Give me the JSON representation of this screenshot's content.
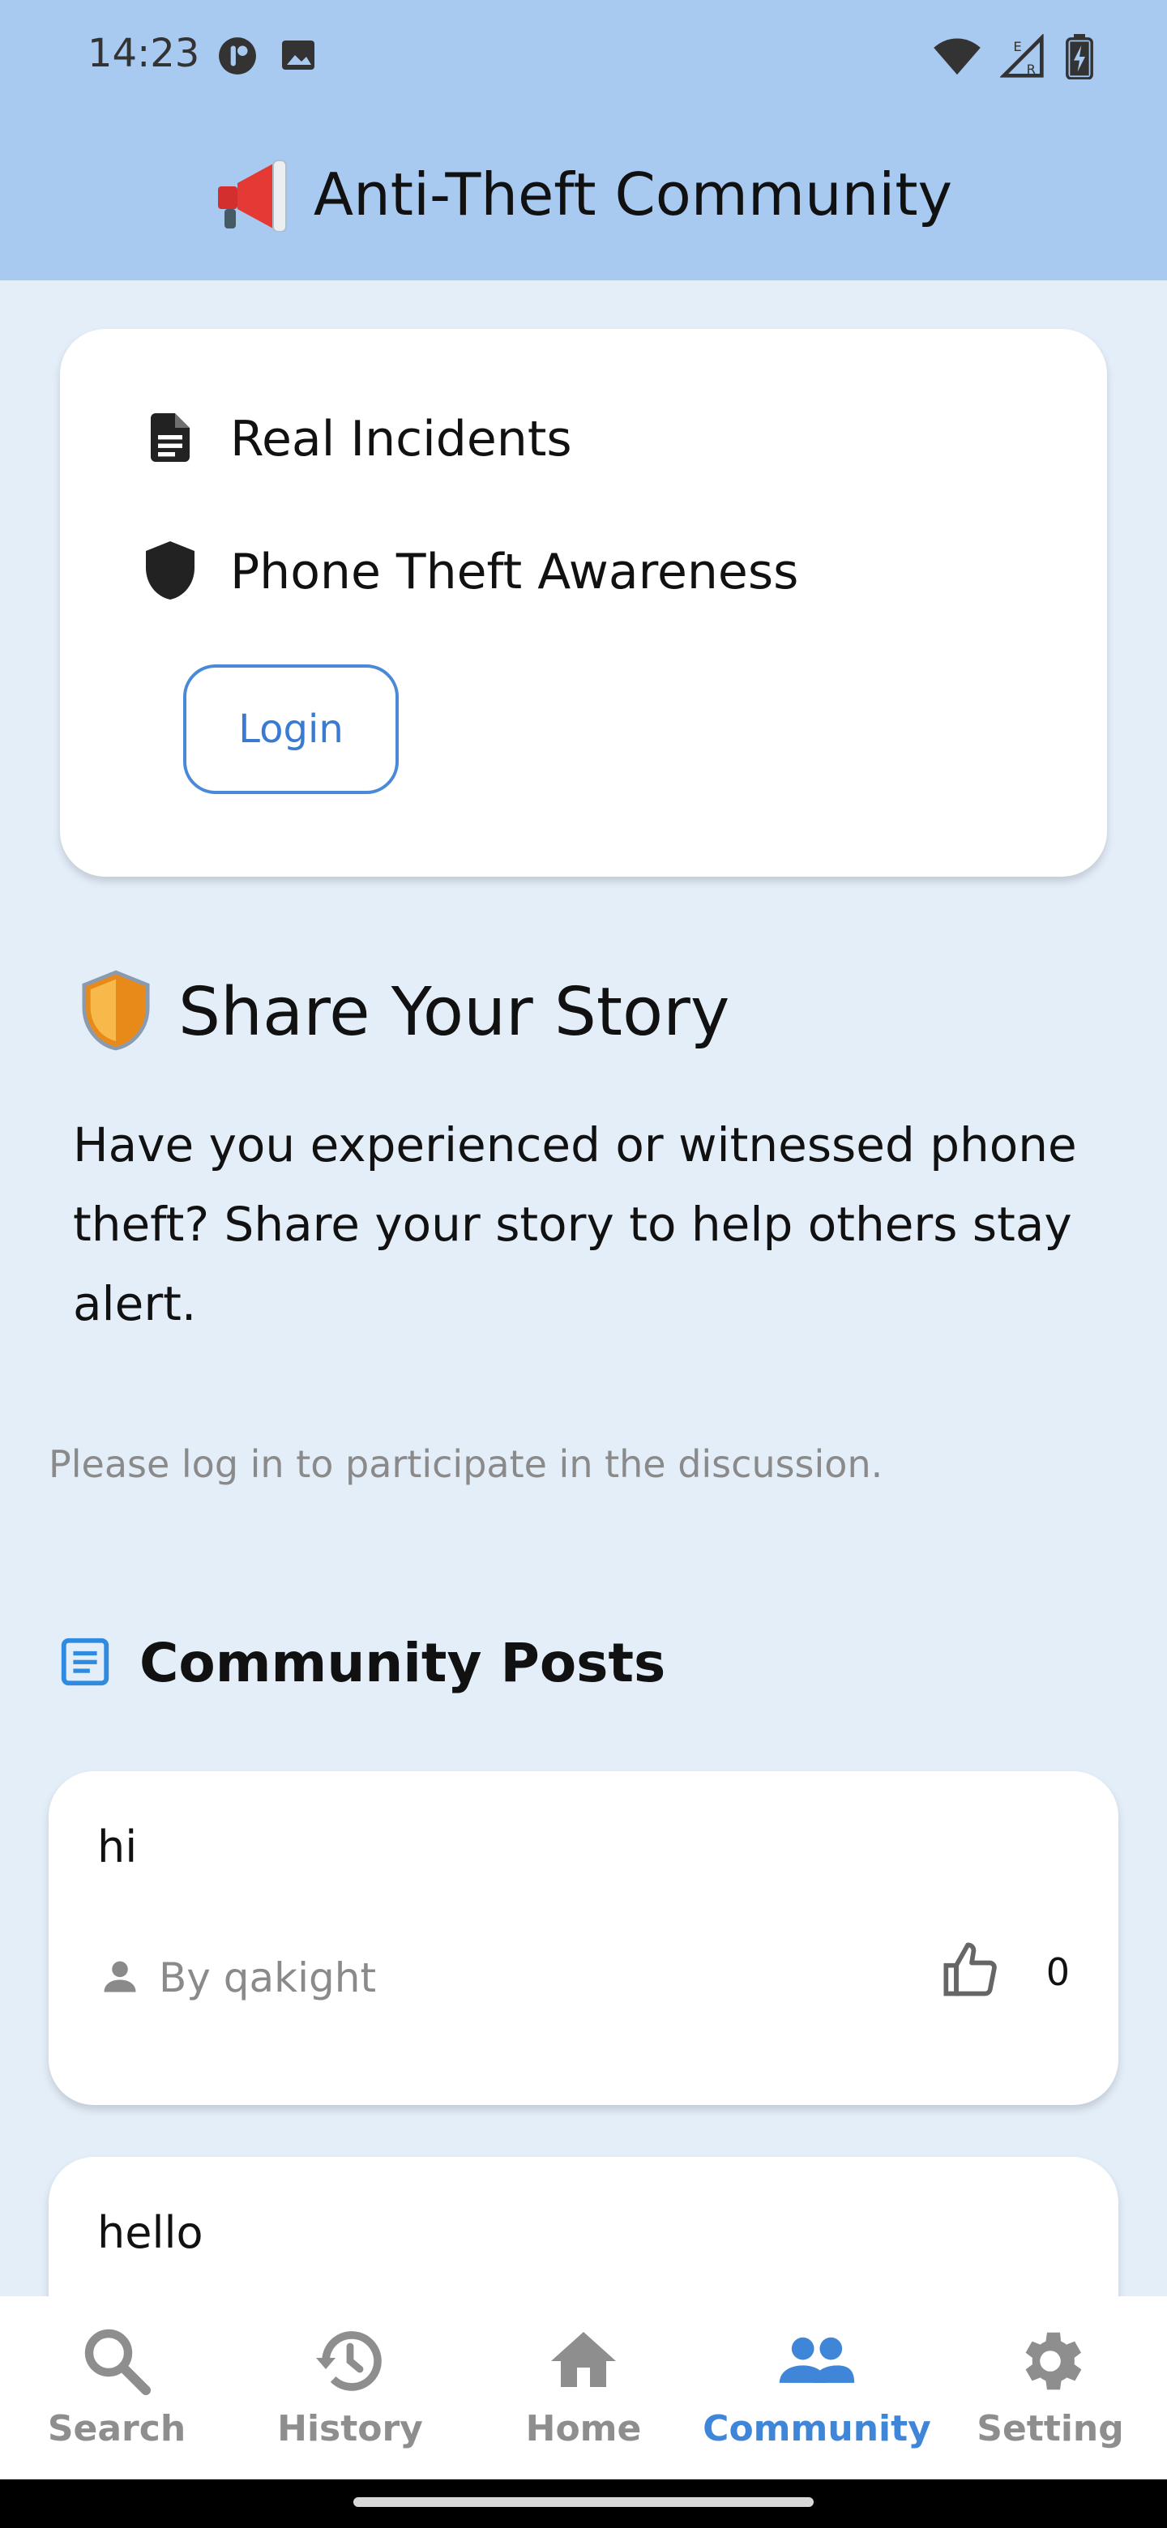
{
  "status_bar": {
    "time": "14:23",
    "left_icons": [
      "app-notification-icon",
      "image-icon"
    ],
    "right_icons": [
      "wifi-icon",
      "signal-icon",
      "battery-charging-icon"
    ]
  },
  "header": {
    "icon": "megaphone-icon",
    "title": "Anti-Theft Community"
  },
  "info_card": {
    "items": [
      {
        "icon": "document-icon",
        "label": "Real Incidents"
      },
      {
        "icon": "shield-icon",
        "label": "Phone Theft Awareness"
      }
    ],
    "login_label": "Login"
  },
  "share": {
    "icon": "shield-icon",
    "heading": "Share Your Story",
    "body": "Have you experienced or witnessed phone theft? Share your story to help others stay alert.",
    "login_note": "Please log in to participate in the discussion."
  },
  "posts": {
    "icon": "article-icon",
    "heading": "Community Posts",
    "items": [
      {
        "title": "hi",
        "author": "By qakight",
        "likes": "0"
      },
      {
        "title": "hello"
      }
    ]
  },
  "bottom_nav": {
    "items": [
      {
        "label": "Search",
        "icon": "search-icon",
        "active": false
      },
      {
        "label": "History",
        "icon": "history-icon",
        "active": false
      },
      {
        "label": "Home",
        "icon": "home-icon",
        "active": false
      },
      {
        "label": "Community",
        "icon": "people-icon",
        "active": true
      },
      {
        "label": "Setting",
        "icon": "gear-icon",
        "active": false
      }
    ]
  },
  "colors": {
    "header_bg": "#a8c9f0",
    "page_bg": "#e4eef9",
    "accent": "#3f86d8",
    "muted_text": "#8a8a8a"
  }
}
